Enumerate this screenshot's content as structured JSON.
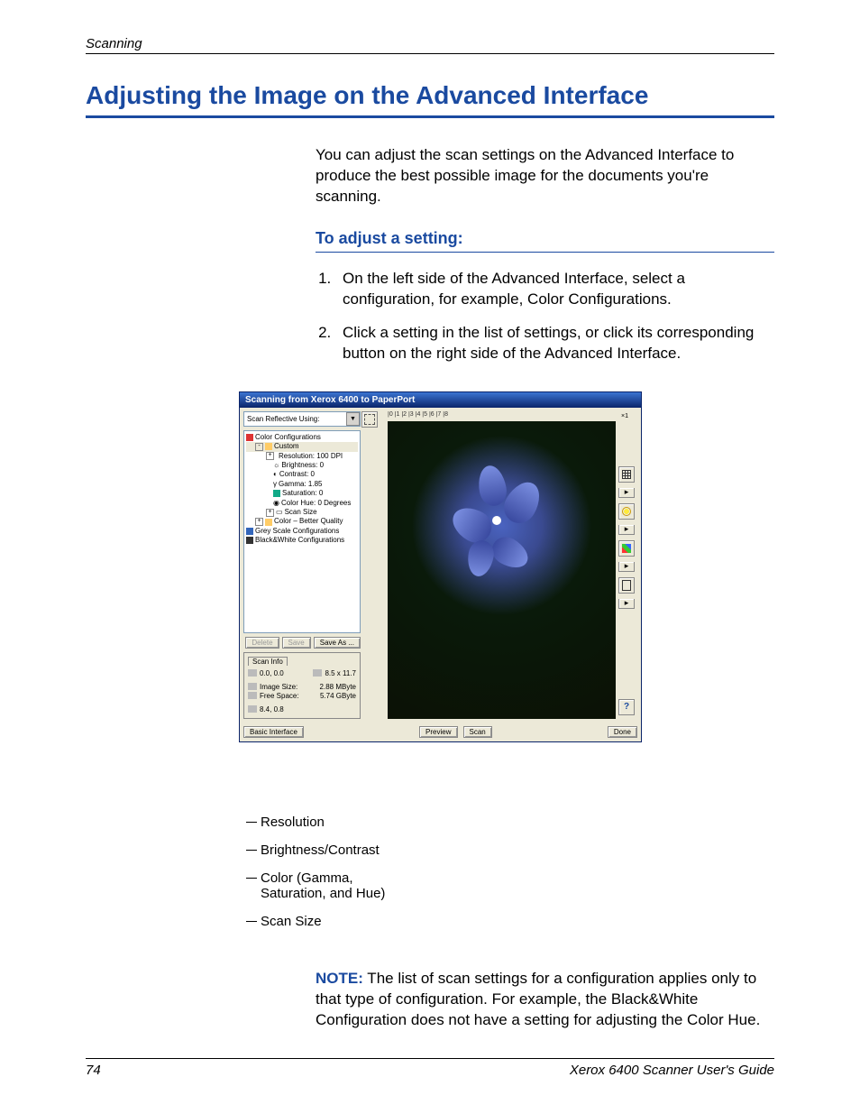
{
  "header": {
    "running": "Scanning"
  },
  "section": {
    "title": "Adjusting the Image on the Advanced Interface"
  },
  "intro": "You can adjust the scan settings on the Advanced Interface to produce the best possible image for the documents you're scanning.",
  "subhead": "To adjust a setting:",
  "steps": [
    "On the left side of the Advanced Interface, select a configuration, for example, Color Configurations.",
    "Click a setting in the list of settings, or click its corresponding button on the right side of the Advanced Interface."
  ],
  "screenshot": {
    "title": "Scanning from Xerox 6400 to PaperPort",
    "combo": "Scan Reflective Using:",
    "tree": {
      "root": "Color Configurations",
      "custom": "Custom",
      "items": [
        "Resolution: 100 DPI",
        "Brightness: 0",
        "Contrast: 0",
        "Gamma: 1.85",
        "Saturation: 0",
        "Color Hue: 0 Degrees",
        "Scan Size"
      ],
      "better": "Color – Better Quality",
      "grey": "Grey Scale Configurations",
      "bw": "Black&White Configurations"
    },
    "buttons": {
      "delete": "Delete",
      "save": "Save",
      "saveas": "Save As ..."
    },
    "scaninfo": {
      "tab": "Scan Info",
      "pos": "0.0, 0.0",
      "dim": "8.5 x 11.7",
      "imgsize_l": "Image Size:",
      "imgsize_v": "2.88 MByte",
      "free_l": "Free Space:",
      "free_v": "5.74 GByte",
      "cursor": "8.4, 0.8"
    },
    "ruler_ticks": "|0        |1        |2        |3        |4        |5        |6        |7        |8",
    "zoom": "×1",
    "bottom": {
      "basic": "Basic Interface",
      "preview": "Preview",
      "scan": "Scan",
      "done": "Done"
    }
  },
  "callouts": {
    "res": "Resolution",
    "bc": "Brightness/Contrast",
    "color1": "Color (Gamma,",
    "color2": "Saturation, and Hue)",
    "size": "Scan Size"
  },
  "note": {
    "label": "NOTE:",
    "text": "  The list of scan settings for a configuration applies only to that type of configuration. For example, the Black&White Configuration does not have a setting for adjusting the Color Hue."
  },
  "footer": {
    "page": "74",
    "guide": "Xerox 6400 Scanner User's Guide"
  }
}
